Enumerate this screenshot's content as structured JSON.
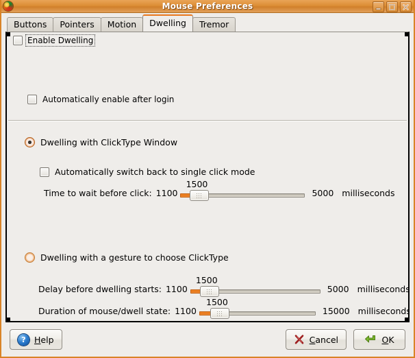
{
  "window": {
    "title": "Mouse Preferences",
    "icon": "gnome-app-icon",
    "buttons": [
      {
        "name": "minimize-button",
        "glyph": "minimize-icon"
      },
      {
        "name": "maximize-button",
        "glyph": "maximize-icon"
      },
      {
        "name": "close-button",
        "glyph": "close-icon"
      }
    ]
  },
  "tabs": [
    {
      "label": "Buttons",
      "active": false
    },
    {
      "label": "Pointers",
      "active": false
    },
    {
      "label": "Motion",
      "active": false
    },
    {
      "label": "Dwelling",
      "active": true
    },
    {
      "label": "Tremor",
      "active": false
    }
  ],
  "dwelling": {
    "enable_dwelling_label": "Enable Dwelling",
    "enable_dwelling_checked": false,
    "auto_enable_label": "Automatically enable after login",
    "auto_enable_checked": false,
    "mode_clicktype_window": {
      "label": "Dwelling with ClickType Window",
      "selected": true
    },
    "auto_switch_back_label": "Automatically switch back to single click mode",
    "auto_switch_back_checked": false,
    "mode_gesture": {
      "label": "Dwelling with a gesture to choose ClickType",
      "selected": false
    },
    "sliders": [
      {
        "name": "time-to-wait-before-click",
        "label": "Time to wait before click:",
        "min": "1100",
        "max": "5000",
        "value": "1500",
        "unit": "milliseconds"
      },
      {
        "name": "delay-before-dwelling-starts",
        "label": "Delay before dwelling starts:",
        "min": "1100",
        "max": "5000",
        "value": "1500",
        "unit": "milliseconds"
      },
      {
        "name": "duration-of-mouse-dwell-state",
        "label": "Duration of mouse/dwell state:",
        "min": "1100",
        "max": "15000",
        "value": "1500",
        "unit": "milliseconds"
      }
    ]
  },
  "actions": {
    "help": {
      "label_pre": "",
      "label_mnemonic": "H",
      "label_post": "elp"
    },
    "cancel": {
      "label_pre": "",
      "label_mnemonic": "C",
      "label_post": "ancel"
    },
    "ok": {
      "label_pre": "",
      "label_mnemonic": "O",
      "label_post": "K"
    }
  },
  "colors": {
    "titlebar": "#dd8e36",
    "accent_orange": "#e8761a",
    "background": "#efedea",
    "help_blue": "#2f7fd0",
    "cancel_red": "#b02424",
    "ok_green": "#7cb82f"
  }
}
